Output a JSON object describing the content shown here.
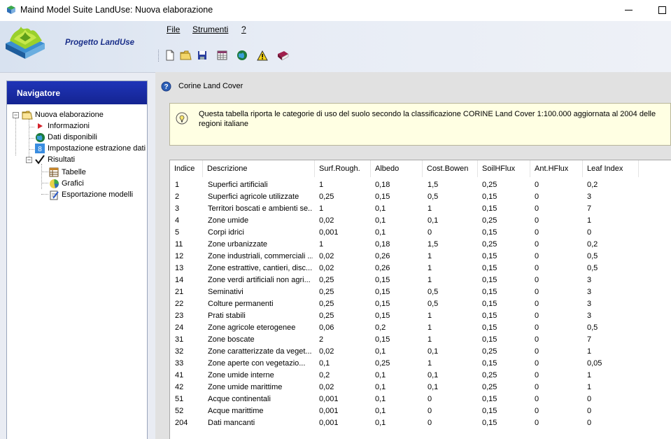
{
  "window": {
    "title": "Maind Model Suite LandUse: Nuova elaborazione"
  },
  "header": {
    "project_label": "Progetto LandUse"
  },
  "menu": {
    "file": "File",
    "strumenti": "Strumenti",
    "help": "?"
  },
  "toolbar": {
    "icons": [
      "new-document-icon",
      "open-folder-icon",
      "save-icon",
      "calendar-grid-icon",
      "globe-icon",
      "warning-icon",
      "book-icon"
    ]
  },
  "navigator": {
    "title": "Navigatore",
    "root": "Nuova elaborazione",
    "items": {
      "informazioni": "Informazioni",
      "dati_disponibili": "Dati disponibili",
      "impostazione": "Impostazione estrazione dati",
      "risultati": "Risultati",
      "tabelle": "Tabelle",
      "grafici": "Grafici",
      "esportazione": "Esportazione modelli"
    }
  },
  "content": {
    "section_title": "Corine Land Cover",
    "info_text": "Questa tabella riporta le categorie di uso del suolo secondo la classificazione CORINE Land Cover 1:100.000 aggiornata al 2004 delle regioni italiane"
  },
  "table": {
    "columns": [
      "Indice",
      "Descrizione",
      "Surf.Rough.",
      "Albedo",
      "Cost.Bowen",
      "SoilHFlux",
      "Ant.HFlux",
      "Leaf Index"
    ],
    "rows": [
      [
        "1",
        "Superfici artificiali",
        "1",
        "0,18",
        "1,5",
        "0,25",
        "0",
        "0,2"
      ],
      [
        "2",
        "Superfici agricole utilizzate",
        "0,25",
        "0,15",
        "0,5",
        "0,15",
        "0",
        "3"
      ],
      [
        "3",
        "Territori boscati e ambienti se...",
        "1",
        "0,1",
        "1",
        "0,15",
        "0",
        "7"
      ],
      [
        "4",
        "Zone umide",
        "0,02",
        "0,1",
        "0,1",
        "0,25",
        "0",
        "1"
      ],
      [
        "5",
        "Corpi idrici",
        "0,001",
        "0,1",
        "0",
        "0,15",
        "0",
        "0"
      ],
      [
        "11",
        "Zone urbanizzate",
        "1",
        "0,18",
        "1,5",
        "0,25",
        "0",
        "0,2"
      ],
      [
        "12",
        "Zone industriali, commerciali ...",
        "0,02",
        "0,26",
        "1",
        "0,15",
        "0",
        "0,5"
      ],
      [
        "13",
        "Zone estrattive, cantieri, disc...",
        "0,02",
        "0,26",
        "1",
        "0,15",
        "0",
        "0,5"
      ],
      [
        "14",
        "Zone verdi artificiali non agri...",
        "0,25",
        "0,15",
        "1",
        "0,15",
        "0",
        "3"
      ],
      [
        "21",
        "Seminativi",
        "0,25",
        "0,15",
        "0,5",
        "0,15",
        "0",
        "3"
      ],
      [
        "22",
        "Colture permanenti",
        "0,25",
        "0,15",
        "0,5",
        "0,15",
        "0",
        "3"
      ],
      [
        "23",
        "Prati stabili",
        "0,25",
        "0,15",
        "1",
        "0,15",
        "0",
        "3"
      ],
      [
        "24",
        "Zone agricole eterogenee",
        "0,06",
        "0,2",
        "1",
        "0,15",
        "0",
        "0,5"
      ],
      [
        "31",
        "Zone boscate",
        "2",
        "0,15",
        "1",
        "0,15",
        "0",
        "7"
      ],
      [
        "32",
        "Zone caratterizzate da veget...",
        "0,02",
        "0,1",
        "0,1",
        "0,25",
        "0",
        "1"
      ],
      [
        "33",
        "Zone aperte con vegetazio...",
        "0,1",
        "0,25",
        "1",
        "0,15",
        "0",
        "0,05"
      ],
      [
        "41",
        "Zone umide interne",
        "0,2",
        "0,1",
        "0,1",
        "0,25",
        "0",
        "1"
      ],
      [
        "42",
        "Zone umide marittime",
        "0,02",
        "0,1",
        "0,1",
        "0,25",
        "0",
        "1"
      ],
      [
        "51",
        "Acque continentali",
        "0,001",
        "0,1",
        "0",
        "0,15",
        "0",
        "0"
      ],
      [
        "52",
        "Acque marittime",
        "0,001",
        "0,1",
        "0",
        "0,15",
        "0",
        "0"
      ],
      [
        "204",
        "Dati mancanti",
        "0,001",
        "0,1",
        "0",
        "0,15",
        "0",
        "0"
      ]
    ]
  }
}
